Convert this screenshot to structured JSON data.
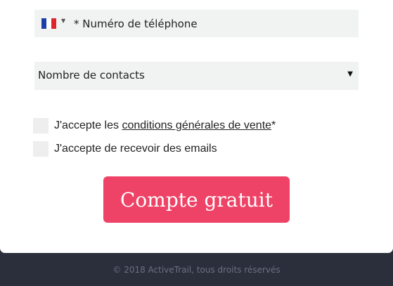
{
  "form": {
    "phone": {
      "country_flag": "FR",
      "placeholder": "* Numéro de téléphone",
      "flag_colors": [
        "#1d3fa8",
        "#ffffff",
        "#e0242b"
      ]
    },
    "contacts_select": {
      "value": "Nombre de contacts"
    },
    "terms": {
      "label_prefix": "J'accepte les ",
      "link_text": "conditions générales de vente",
      "label_suffix": "*"
    },
    "emails": {
      "label": "J'accepte de recevoir des emails"
    },
    "submit_label": "Compte gratuit",
    "accent_color": "#ee4266"
  },
  "footer": {
    "copyright": "© 2018 ActiveTrail, tous droits réservés"
  }
}
